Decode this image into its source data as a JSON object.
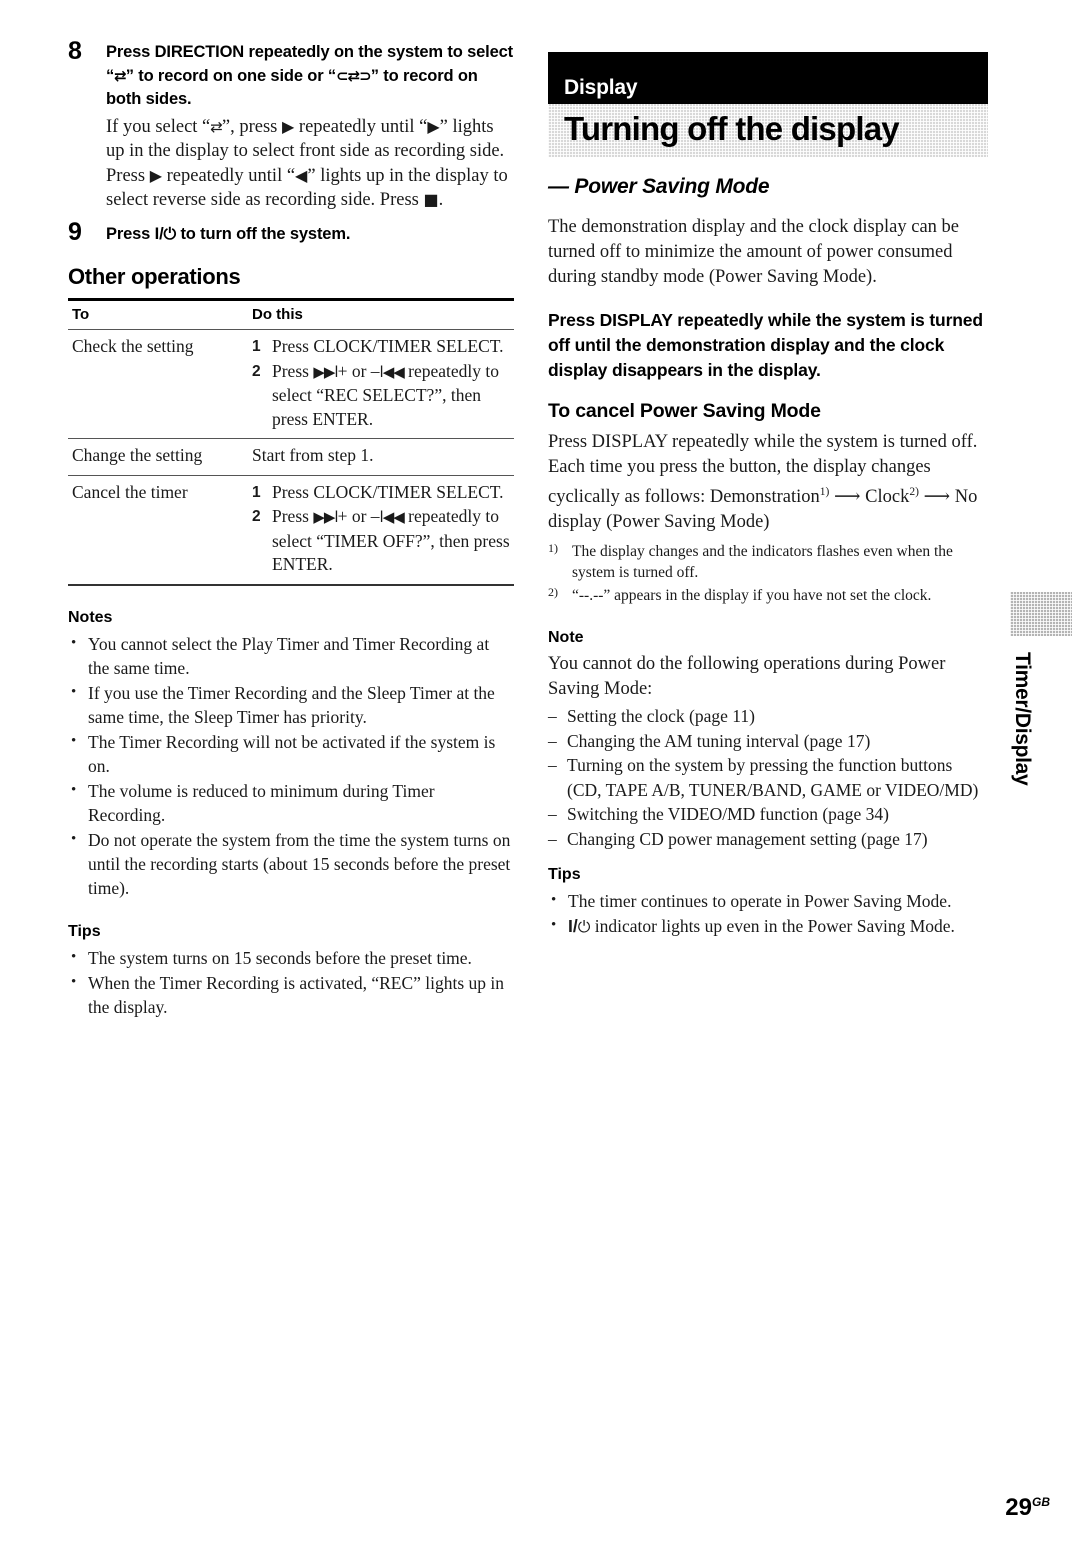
{
  "page": {
    "number": "29",
    "region_code": "GB"
  },
  "side_tab": {
    "label": "Timer/Display"
  },
  "left_column": {
    "steps": [
      {
        "num": "8",
        "heading_parts": {
          "a": "Press DIRECTION repeatedly on the system to select “",
          "glyph_one_side": "⇄",
          "b": "” to record on one side or “",
          "glyph_both_sides": "⊂⇄⊃",
          "c": "” to record on both sides."
        },
        "sub_parts": {
          "a": "If you select “",
          "g1": "⇄",
          "b": "”, press ",
          "g2": "▶",
          "c": " repeatedly until “",
          "g3": "▶",
          "d": "” lights up in the display to select front side as recording side. Press ",
          "g4": "▶",
          "e": " repeatedly until “",
          "g5": "◀",
          "f": "” lights up in the display to select reverse side as recording side. Press ",
          "g6": "■",
          "g": "."
        }
      },
      {
        "num": "9",
        "heading_parts": {
          "a": "Press I/",
          "glyph_power": "⏻",
          "b": " to turn off the system."
        }
      }
    ],
    "other_operations": {
      "title": "Other operations",
      "columns": [
        "To",
        "Do this"
      ],
      "rows": [
        {
          "to": "Check the setting",
          "substeps": [
            {
              "n": "1",
              "text": "Press CLOCK/TIMER SELECT."
            },
            {
              "n": "2",
              "parts": {
                "a": "Press ",
                "g1": "▶▶l",
                "b": "+ or –",
                "g2": "l◀◀",
                "c": " repeatedly to select “REC SELECT?”, then press ENTER."
              }
            }
          ]
        },
        {
          "to": "Change the setting",
          "simple": "Start from step 1."
        },
        {
          "to": "Cancel the timer",
          "substeps": [
            {
              "n": "1",
              "text": "Press CLOCK/TIMER SELECT."
            },
            {
              "n": "2",
              "parts": {
                "a": "Press ",
                "g1": "▶▶l",
                "b": "+ or –",
                "g2": "l◀◀",
                "c": " repeatedly to select “TIMER OFF?”, then press ENTER."
              }
            }
          ]
        }
      ]
    },
    "notes": {
      "title": "Notes",
      "items": [
        "You cannot select the Play Timer and Timer Recording at the same time.",
        "If you use the Timer Recording and the Sleep Timer at the same time, the Sleep Timer has priority.",
        "The Timer Recording will not be activated if the system is on.",
        "The volume is reduced to minimum during Timer Recording.",
        "Do not operate the system from the time the system turns on until the recording starts (about 15 seconds before the preset time)."
      ]
    },
    "tips": {
      "title": "Tips",
      "items": [
        "The system turns on 15 seconds before the preset time.",
        "When the Timer Recording is activated, “REC” lights up in the display."
      ]
    }
  },
  "right_column": {
    "banner": {
      "category": "Display",
      "title": "Turning off the display"
    },
    "subtitle": "— Power Saving Mode",
    "intro": "The demonstration display and the clock display can be turned off to minimize the amount of power consumed during standby mode (Power Saving Mode).",
    "lead_bold": "Press DISPLAY repeatedly while the system is turned off until the demonstration display and the clock display disappears in the display.",
    "cancel": {
      "heading": "To cancel Power Saving Mode",
      "body_parts": {
        "a": "Press DISPLAY repeatedly while the system is turned off. Each time you press the button, the display changes cyclically as follows: Demonstration",
        "ref1": "1)",
        "b": " ⟶ Clock",
        "ref2": "2)",
        "c": " ⟶ No display (Power Saving Mode)"
      }
    },
    "footnotes": [
      {
        "mark": "1)",
        "text": "The display changes and the indicators flashes even when the system is turned off."
      },
      {
        "mark": "2)",
        "text": "“--.--” appears in the display if you have not set the clock."
      }
    ],
    "note": {
      "title": "Note",
      "intro": "You cannot do the following operations during Power Saving Mode:",
      "items": [
        "Setting the clock (page 11)",
        "Changing the AM tuning interval (page 17)",
        "Turning on the system by pressing the function buttons (CD, TAPE A/B, TUNER/BAND, GAME or VIDEO/MD)",
        "Switching the VIDEO/MD function (page 34)",
        "Changing CD power management setting (page 17)"
      ]
    },
    "tips": {
      "title": "Tips",
      "items_parts": [
        {
          "plain": "The timer continues to operate in Power Saving Mode."
        },
        {
          "a": "I/",
          "glyph": "⏻",
          "b": " indicator lights up even in the Power Saving Mode."
        }
      ]
    }
  }
}
